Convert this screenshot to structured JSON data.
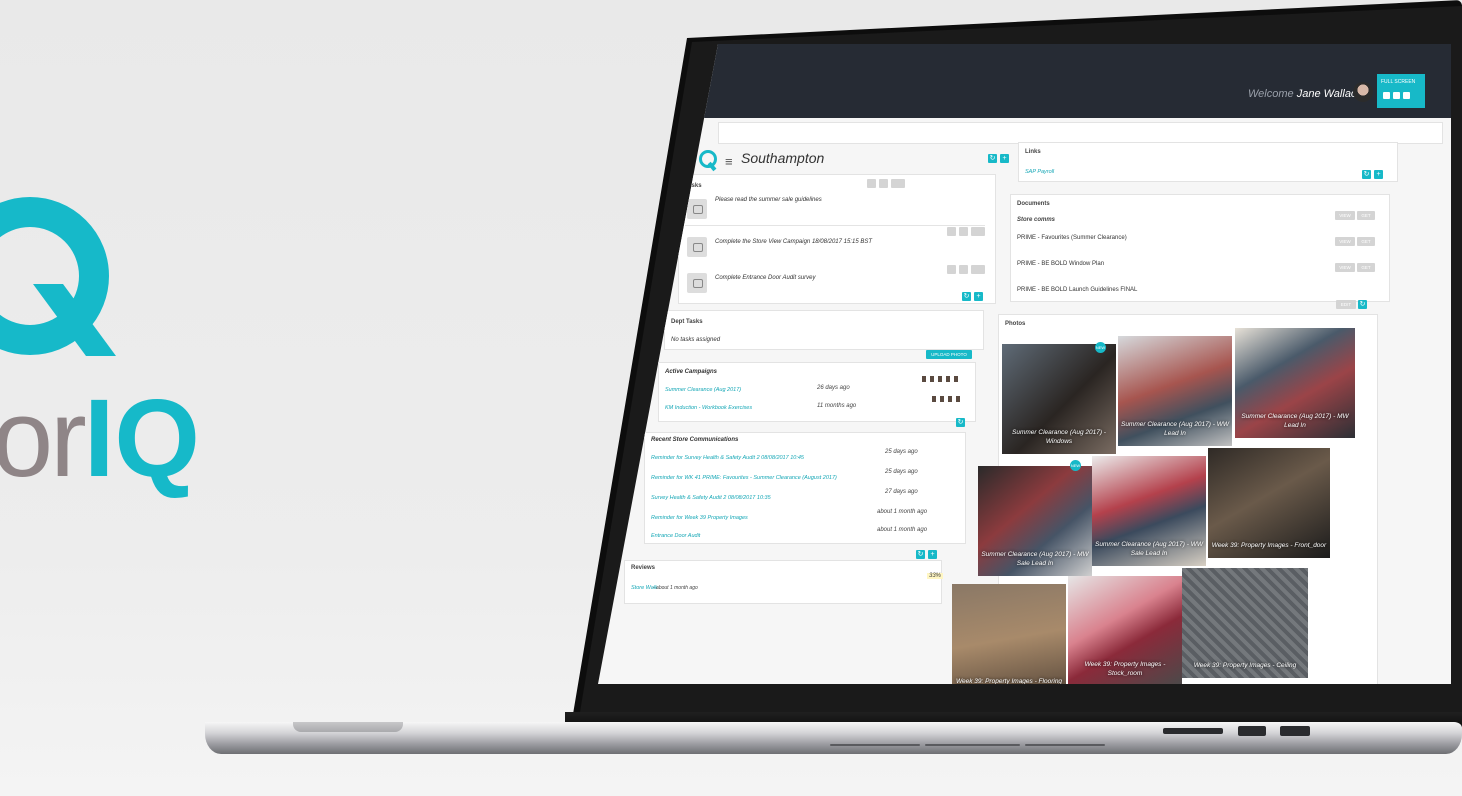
{
  "brand": {
    "text_prefix": "or",
    "text_suffix": "IQ",
    "accent_color": "#16b9c9",
    "icon": "q-logo-icon"
  },
  "topbar": {
    "welcome_label": "Welcome",
    "user_name": "Jane Wallace",
    "fullscreen_label": "FULL SCREEN"
  },
  "header": {
    "store_name": "Southampton",
    "menu_icon": "hamburger-icon"
  },
  "tasks": {
    "title": "Tasks",
    "items": [
      {
        "text": "Please read the summer sale guidelines"
      },
      {
        "text": "Complete the Store View Campaign 18/08/2017 15:15 BST"
      },
      {
        "text": "Complete Entrance Door Audit survey"
      }
    ]
  },
  "dept_tasks": {
    "title": "Dept Tasks",
    "empty": "No tasks assigned",
    "upload_label": "UPLOAD PHOTO"
  },
  "active_campaigns": {
    "title": "Active Campaigns",
    "rows": [
      {
        "name": "Summer Clearance (Aug 2017)",
        "when": "26 days ago"
      },
      {
        "name": "KM Induction - Workbook Exercises",
        "when": "11 months ago"
      }
    ]
  },
  "communications": {
    "title": "Recent Store Communications",
    "rows": [
      {
        "name": "Reminder for Survey Health & Safety Audit 2 08/08/2017 10:45",
        "when": "25 days ago"
      },
      {
        "name": "Reminder for WK 41 PRIME: Favourites - Summer Clearance (August 2017)",
        "when": "25 days ago"
      },
      {
        "name": "Survey Health & Safety Audit 2 08/08/2017 10:35",
        "when": "27 days ago"
      },
      {
        "name": "Reminder for Week 39 Property Images",
        "when": "about 1 month ago"
      },
      {
        "name": "Entrance Door Audit",
        "when": "about 1 month ago"
      }
    ]
  },
  "reviews": {
    "title": "Reviews",
    "row_link": "Store Walk",
    "row_meta": "- about 1 month ago",
    "score": "33%"
  },
  "links": {
    "title": "Links",
    "item": "SAP Payroll"
  },
  "documents": {
    "title": "Documents",
    "group": "Store comms",
    "rows": [
      {
        "name": "PRIME - Favourites (Summer Clearance)"
      },
      {
        "name": "PRIME - BE BOLD Window Plan"
      },
      {
        "name": "PRIME - BE BOLD Launch Guidelines FINAL"
      }
    ],
    "view_label": "VIEW",
    "get_label": "GET",
    "edit_label": "EDIT"
  },
  "photos": {
    "title": "Photos",
    "items": [
      {
        "caption": "Summer Clearance (Aug 2017) - Windows",
        "badge": "NEW"
      },
      {
        "caption": "Summer Clearance (Aug 2017) - WW Lead In",
        "badge": ""
      },
      {
        "caption": "Summer Clearance (Aug 2017) - MW Lead In",
        "badge": ""
      },
      {
        "caption": "Summer Clearance (Aug 2017) - MW Sale Lead In",
        "badge": "NEW"
      },
      {
        "caption": "Summer Clearance (Aug 2017) - WW Sale Lead In",
        "badge": ""
      },
      {
        "caption": "Week 39: Property Images - Front_door",
        "badge": ""
      },
      {
        "caption": "Week 39: Property Images - Flooring",
        "badge": ""
      },
      {
        "caption": "Week 39: Property Images - Stock_room",
        "badge": ""
      },
      {
        "caption": "Week 39: Property Images - Ceiling",
        "badge": ""
      }
    ]
  }
}
